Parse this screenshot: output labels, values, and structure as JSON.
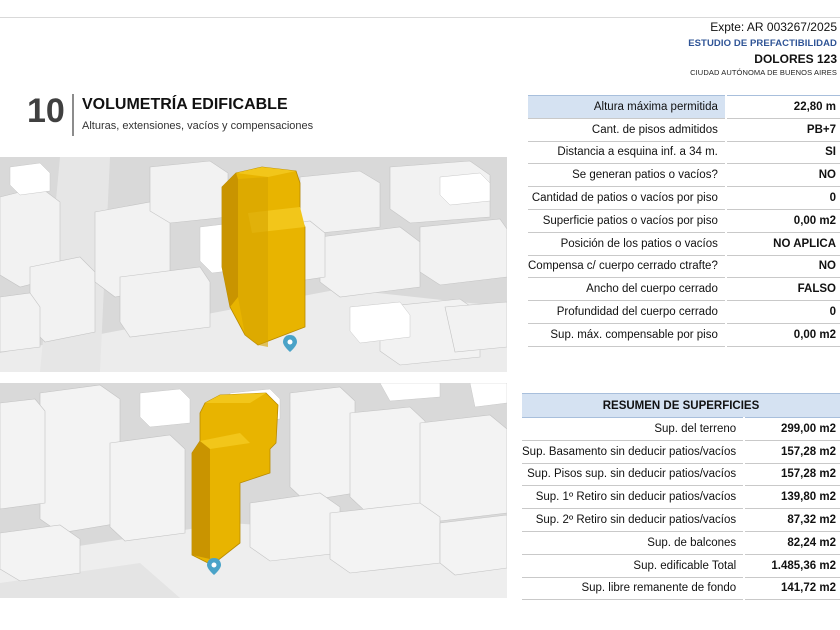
{
  "header": {
    "expte": "Expte: AR 003267/2025",
    "estudio": "ESTUDIO DE PREFACTIBILIDAD",
    "address": "DOLORES 123",
    "city": "CIUDAD AUTÓNOMA DE BUENOS AIRES"
  },
  "section": {
    "number": "10",
    "title": "VOLUMETRÍA EDIFICABLE",
    "subtitle": "Alturas, extensiones, vacíos y compensaciones"
  },
  "colors": {
    "volume": "#e8b400",
    "volume_shade": "#c99400",
    "header_fill": "#d5e2f2",
    "accent": "#2f5496"
  },
  "views": {
    "marker_icon": "map-pin-icon"
  },
  "params": [
    {
      "label": "Altura máxima permitida",
      "value": "22,80 m"
    },
    {
      "label": "Cant. de pisos admitidos",
      "value": "PB+7"
    },
    {
      "label": "Distancia a esquina inf. a 34 m.",
      "value": "SI"
    },
    {
      "label": "Se generan patios o vacíos?",
      "value": "NO"
    },
    {
      "label": "Cantidad de patios o vacíos por piso",
      "value": "0"
    },
    {
      "label": "Superficie patios o vacíos por piso",
      "value": "0,00 m2"
    },
    {
      "label": "Posición de los patios o vacíos",
      "value": "NO APLICA"
    },
    {
      "label": "Compensa c/ cuerpo cerrado ctrafte?",
      "value": "NO"
    },
    {
      "label": "Ancho del cuerpo cerrado",
      "value": "FALSO"
    },
    {
      "label": "Profundidad del cuerpo cerrado",
      "value": "0"
    },
    {
      "label": "Sup. máx. compensable por piso",
      "value": "0,00 m2"
    }
  ],
  "resumen": {
    "title": "RESUMEN DE SUPERFICIES",
    "rows": [
      {
        "label": "Sup. del terreno",
        "value": "299,00 m2"
      },
      {
        "label": "Sup. Basamento sin deducir patios/vacíos",
        "value": "157,28 m2"
      },
      {
        "label": "Sup. Pisos sup. sin deducir patios/vacíos",
        "value": "157,28 m2"
      },
      {
        "label": "Sup. 1º Retiro sin deducir patios/vacíos",
        "value": "139,80 m2"
      },
      {
        "label": "Sup. 2º Retiro sin deducir patios/vacíos",
        "value": "87,32 m2"
      },
      {
        "label": "Sup. de balcones",
        "value": "82,24 m2"
      },
      {
        "label": "Sup. edificable Total",
        "value": "1.485,36 m2"
      },
      {
        "label": "Sup. libre remanente de fondo",
        "value": "141,72 m2"
      }
    ]
  }
}
